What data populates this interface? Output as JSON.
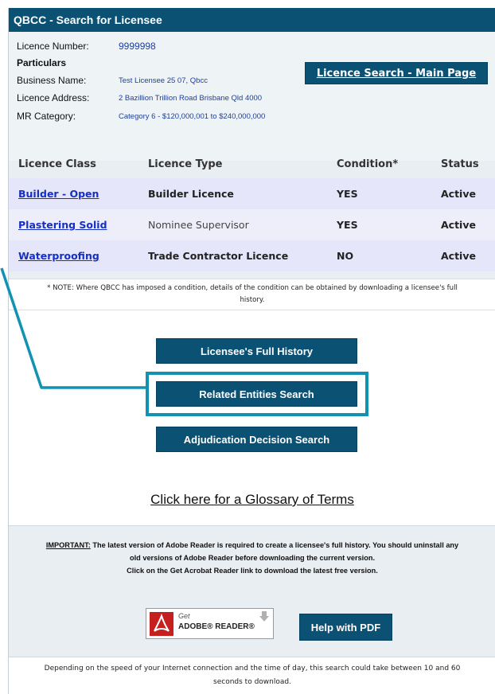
{
  "window": {
    "title": "QBCC - Search for Licensee"
  },
  "details": {
    "licence_number_label": "Licence Number:",
    "licence_number": "9999998",
    "particulars_label": "Particulars",
    "business_name_label": "Business Name:",
    "business_name": "Test Licensee 25 07, Qbcc",
    "licence_address_label": "Licence Address:",
    "licence_address": "2 Bazillion Trillion Road Brisbane Qld 4000",
    "mr_category_label": "MR Category:",
    "mr_category": "Category 6 - $120,000,001 to $240,000,000"
  },
  "buttons": {
    "main_search": "Licence Search - Main Page",
    "full_history": "Licensee's Full History",
    "related_entities": "Related Entities Search",
    "adjudication": "Adjudication Decision Search",
    "help_pdf": "Help with PDF"
  },
  "table": {
    "headers": {
      "licence_class": "Licence Class",
      "licence_type": "Licence Type",
      "condition": "Condition*",
      "status": "Status"
    },
    "rows": [
      {
        "licence_class": "Builder - Open",
        "licence_type": "Builder Licence",
        "condition": "YES",
        "status": "Active"
      },
      {
        "licence_class": "Plastering Solid",
        "licence_type": "Nominee Supervisor",
        "condition": "YES",
        "status": "Active"
      },
      {
        "licence_class": "Waterproofing",
        "licence_type": "Trade Contractor Licence",
        "condition": "NO",
        "status": "Active"
      }
    ]
  },
  "note": {
    "line1": "* NOTE: Where QBCC has imposed a condition, details of the condition can be obtained by downloading a licensee's full",
    "line2": "history."
  },
  "glossary_link": "Click here for a Glossary of Terms",
  "important": {
    "label": "IMPORTANT:",
    "line1": " The latest version of Adobe Reader is required to create a licensee's full history. You should uninstall any",
    "line2": "old versions of Adobe Reader before downloading the current version.",
    "line3": "Click on the Get Acrobat Reader link to download the latest free version."
  },
  "adobe": {
    "get": "Get",
    "name": "ADOBE® READER®"
  },
  "footer": {
    "line1": "Depending on the speed of your Internet connection and the time of day, this search could take between 10 and 60",
    "line2": "seconds to download."
  },
  "colors": {
    "header_bg": "#0b5173",
    "link": "#1530c2",
    "highlight": "#1192b3",
    "row_bg": "#e6e6fb"
  }
}
